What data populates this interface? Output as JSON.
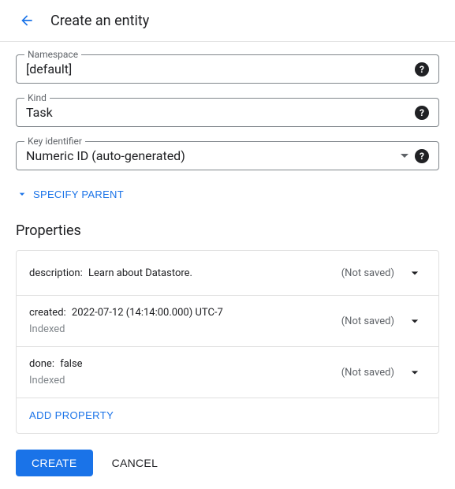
{
  "header": {
    "title": "Create an entity"
  },
  "fields": {
    "namespace": {
      "label": "Namespace",
      "value": "[default]"
    },
    "kind": {
      "label": "Kind",
      "value": "Task"
    },
    "key_identifier": {
      "label": "Key identifier",
      "value": "Numeric ID (auto-generated)"
    }
  },
  "specify_parent": "SPECIFY PARENT",
  "properties": {
    "title": "Properties",
    "indexed_label": "Indexed",
    "not_saved": "(Not saved)",
    "items": [
      {
        "key": "description:",
        "value": "Learn about Datastore.",
        "indexed": false
      },
      {
        "key": "created:",
        "value": "2022-07-12 (14:14:00.000) UTC-7",
        "indexed": true
      },
      {
        "key": "done:",
        "value": "false",
        "indexed": true
      }
    ],
    "add_label": "ADD PROPERTY"
  },
  "actions": {
    "create": "CREATE",
    "cancel": "CANCEL"
  }
}
